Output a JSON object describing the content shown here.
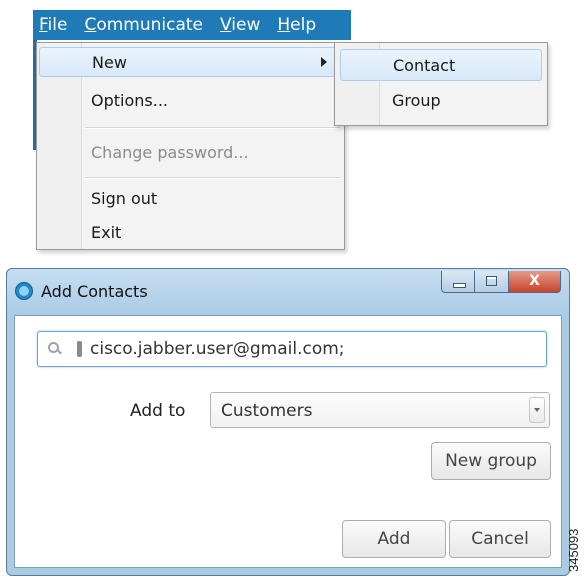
{
  "menubar": {
    "items": [
      {
        "accel": "F",
        "rest": "ile"
      },
      {
        "accel": "C",
        "rest": "ommunicate"
      },
      {
        "accel": "V",
        "rest": "iew"
      },
      {
        "accel": "H",
        "rest": "elp"
      }
    ]
  },
  "file_menu": {
    "new": "New",
    "options": "Options...",
    "change_password": "Change password...",
    "sign_out": "Sign out",
    "exit": "Exit"
  },
  "new_submenu": {
    "contact": "Contact",
    "group": "Group"
  },
  "dialog": {
    "title": "Add Contacts",
    "close_glyph": "X",
    "search_value": "cisco.jabber.user@gmail.com;",
    "add_to_label": "Add to",
    "add_to_value": "Customers",
    "new_group_button": "New group",
    "add_button": "Add",
    "cancel_button": "Cancel"
  },
  "figure_id": "345093",
  "colors": {
    "menubar": "#1f7ab8",
    "highlight": "#d8e9f9",
    "dialog_frame": "#a9cbe6",
    "close_button": "#c7442c"
  }
}
